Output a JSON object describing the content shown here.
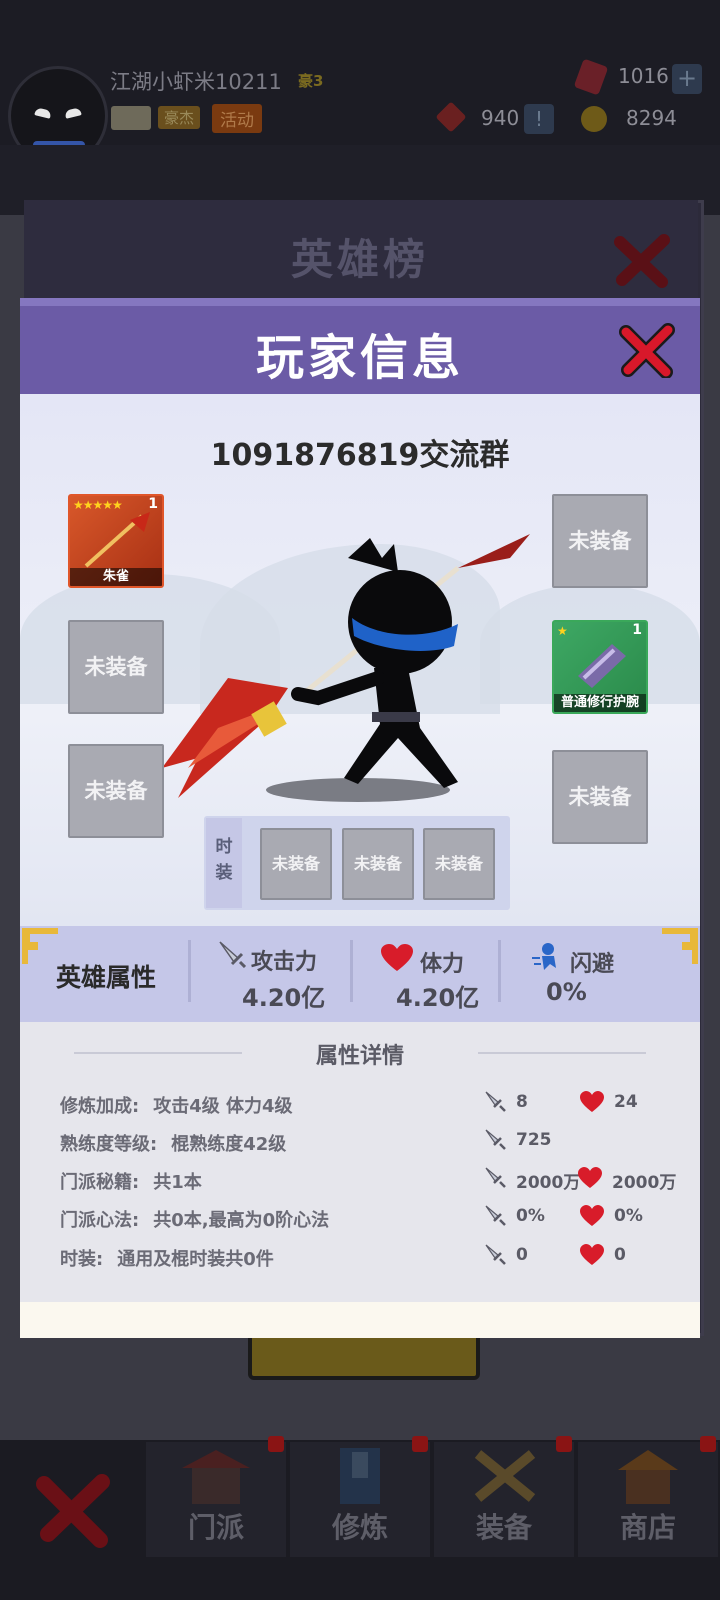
{
  "top_bar": {
    "player_name": "江湖小虾米10211",
    "player_rank": "豪3",
    "tag_hero": "豪杰",
    "tag_event": "活动",
    "gems": "1016",
    "coupons": "940",
    "coins": "8294",
    "plus_label": "+",
    "alert_label": "!"
  },
  "bottom_nav": {
    "items": [
      {
        "label": "门派",
        "icon": "sect-building-icon"
      },
      {
        "label": "修炼",
        "icon": "manual-book-icon"
      },
      {
        "label": "装备",
        "icon": "equipment-swords-icon"
      },
      {
        "label": "商店",
        "icon": "shop-icon"
      }
    ]
  },
  "board": {
    "title": "英雄榜"
  },
  "popup": {
    "title": "玩家信息",
    "group_title": "1091876819交流群",
    "empty_slot_label": "未装备",
    "weapon": {
      "name": "朱雀",
      "stars": "★★★★★",
      "count": "1"
    },
    "bracer": {
      "name": "普通修行护腕",
      "stars": "★",
      "count": "1"
    },
    "fashion_label": "时装",
    "attributes": {
      "title": "英雄属性",
      "attack_label": "攻击力",
      "attack_value": "4.20亿",
      "hp_label": "体力",
      "hp_value": "4.20亿",
      "dodge_label": "闪避",
      "dodge_value": "0%"
    },
    "details": {
      "title": "属性详情",
      "rows": [
        {
          "label": "修炼加成:",
          "desc": "攻击4级 体力4级",
          "atk": "8",
          "hp": "24"
        },
        {
          "label": "熟练度等级:",
          "desc": "棍熟练度42级",
          "atk": "725",
          "hp": ""
        },
        {
          "label": "门派秘籍:",
          "desc": "共1本",
          "atk": "2000万",
          "hp": "2000万"
        },
        {
          "label": "门派心法:",
          "desc": "共0本,最高为0阶心法",
          "atk": "0%",
          "hp": "0%"
        },
        {
          "label": "时装:",
          "desc": "通用及棍时装共0件",
          "atk": "0",
          "hp": "0"
        }
      ]
    }
  },
  "colors": {
    "popup_header": "#6b5ba6",
    "attr_bar": "#c5c7e8",
    "close_red": "#d8182a"
  }
}
